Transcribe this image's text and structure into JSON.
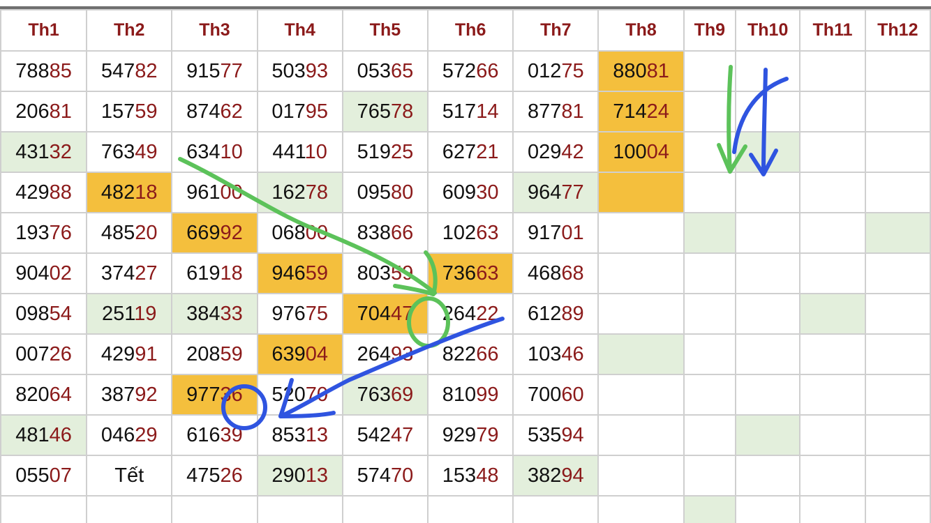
{
  "headers": [
    "Th1",
    "Th2",
    "Th3",
    "Th4",
    "Th5",
    "Th6",
    "Th7",
    "Th8",
    "Th9",
    "Th10",
    "Th11",
    "Th12"
  ],
  "rows": [
    [
      "78885",
      "54782",
      "91577",
      "50393",
      "05365",
      "57266",
      "01275",
      "88081",
      "",
      "",
      "",
      ""
    ],
    [
      "20681",
      "15759",
      "87462",
      "01795",
      "76578",
      "51714",
      "87781",
      "71424",
      "",
      "",
      "",
      ""
    ],
    [
      "43132",
      "76349",
      "63410",
      "44110",
      "51925",
      "62721",
      "02942",
      "10004",
      "",
      "",
      "",
      ""
    ],
    [
      "42988",
      "48218",
      "96100",
      "16278",
      "09580",
      "60930",
      "96477",
      "",
      "",
      "",
      "",
      ""
    ],
    [
      "19376",
      "48520",
      "66992",
      "06800",
      "83866",
      "10263",
      "91701",
      "",
      "",
      "",
      "",
      ""
    ],
    [
      "90402",
      "37427",
      "61918",
      "94659",
      "80359",
      "73663",
      "46868",
      "",
      "",
      "",
      "",
      ""
    ],
    [
      "09854",
      "25119",
      "38433",
      "97675",
      "70447",
      "26422",
      "61289",
      "",
      "",
      "",
      "",
      ""
    ],
    [
      "00726",
      "42991",
      "20859",
      "63904",
      "26493",
      "82266",
      "10346",
      "",
      "",
      "",
      "",
      ""
    ],
    [
      "82064",
      "38792",
      "97736",
      "52070",
      "76369",
      "81099",
      "70060",
      "",
      "",
      "",
      "",
      ""
    ],
    [
      "48146",
      "04629",
      "61639",
      "85313",
      "54247",
      "92979",
      "53594",
      "",
      "",
      "",
      "",
      ""
    ],
    [
      "05507",
      "Tết",
      "47526",
      "29013",
      "57470",
      "15348",
      "38294",
      "",
      "",
      "",
      "",
      ""
    ],
    [
      "",
      "",
      "",
      "",
      "",
      "",
      "",
      "",
      "",
      "",
      "",
      ""
    ]
  ],
  "cell_highlight": [
    [
      "",
      "",
      "",
      "",
      "",
      "",
      "",
      "orange",
      "",
      "",
      "",
      ""
    ],
    [
      "",
      "",
      "",
      "",
      "green",
      "",
      "",
      "orange",
      "",
      "",
      "",
      ""
    ],
    [
      "green",
      "",
      "",
      "",
      "",
      "",
      "",
      "orange",
      "",
      "green",
      "",
      ""
    ],
    [
      "",
      "orange",
      "",
      "green",
      "",
      "",
      "green",
      "orange",
      "",
      "",
      "",
      ""
    ],
    [
      "",
      "",
      "orange",
      "",
      "",
      "",
      "",
      "",
      "green",
      "",
      "",
      "green"
    ],
    [
      "",
      "",
      "",
      "orange",
      "",
      "orange",
      "",
      "",
      "",
      "",
      "",
      ""
    ],
    [
      "",
      "green",
      "green",
      "",
      "orange",
      "",
      "",
      "",
      "",
      "",
      "green",
      ""
    ],
    [
      "",
      "",
      "",
      "orange",
      "",
      "",
      "",
      "green",
      "",
      "",
      "",
      ""
    ],
    [
      "",
      "",
      "orange",
      "",
      "green",
      "",
      "",
      "",
      "",
      "",
      "",
      ""
    ],
    [
      "green",
      "",
      "",
      "",
      "",
      "",
      "",
      "",
      "",
      "green",
      "",
      ""
    ],
    [
      "",
      "",
      "",
      "green",
      "",
      "",
      "green",
      "",
      "",
      "",
      "",
      ""
    ],
    [
      "",
      "",
      "",
      "",
      "",
      "",
      "",
      "",
      "green",
      "",
      "",
      ""
    ]
  ],
  "colors": {
    "header_text": "#8b1a1a",
    "digit_tail": "#8b1a1a",
    "highlight_orange": "#f4bf3d",
    "highlight_green": "#e3efdc",
    "annotation_green": "#5cc25a",
    "annotation_blue": "#2f54e0"
  }
}
